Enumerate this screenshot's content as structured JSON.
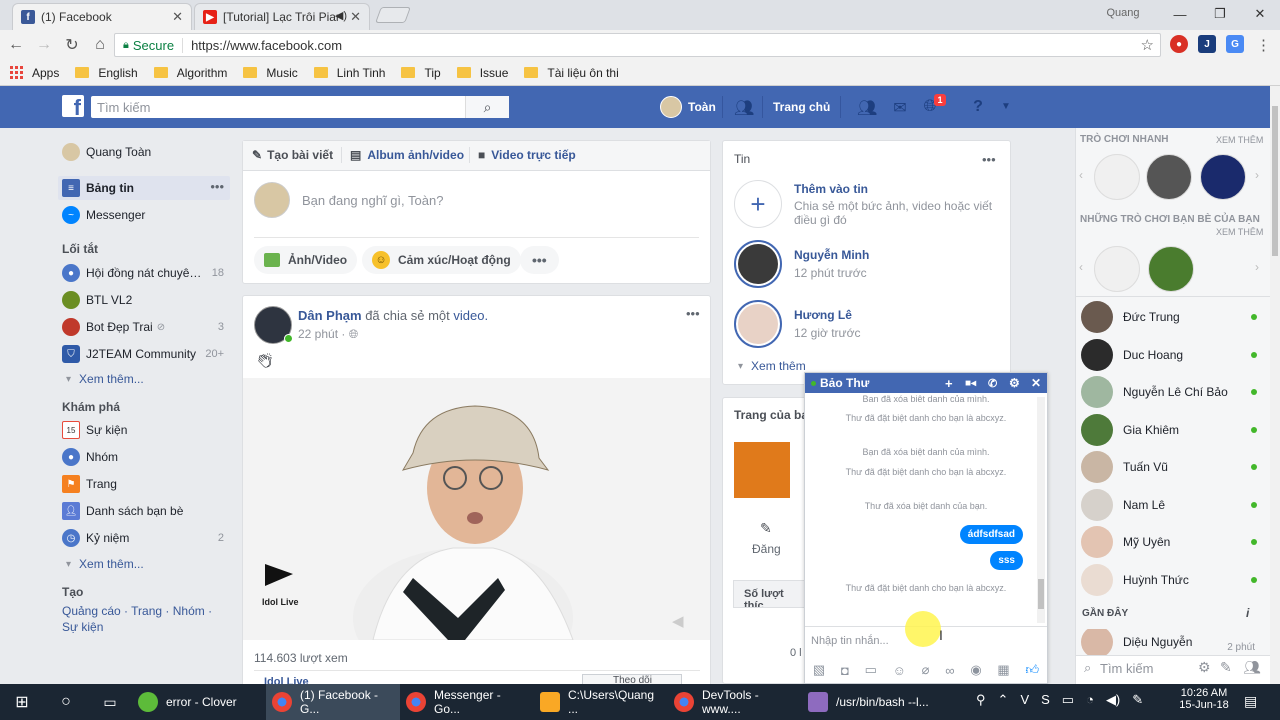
{
  "browser": {
    "tabs": [
      {
        "title": "(1) Facebook",
        "icon": "facebook-icon"
      },
      {
        "title": "[Tutorial] Lạc Trôi Piar",
        "icon": "youtube-icon"
      }
    ],
    "profile": "Quang",
    "secure_label": "Secure",
    "url": "https://www.facebook.com",
    "bookmarks": [
      "Apps",
      "English",
      "Algorithm",
      "Music",
      "Linh Tinh",
      "Tip",
      "Issue",
      "Tài liệu ôn thi"
    ]
  },
  "fb_header": {
    "search_placeholder": "Tìm kiếm",
    "profile_name": "Toàn",
    "home_label": "Trang chủ",
    "notification_count": "1"
  },
  "left_nav": {
    "user": "Quang Toàn",
    "news_feed": "Bảng tin",
    "messenger": "Messenger",
    "shortcuts_title": "Lối tắt",
    "shortcuts": [
      {
        "label": "Hội đồng nát chuyê…",
        "count": "18"
      },
      {
        "label": "BTL VL2",
        "count": ""
      },
      {
        "label": "Bot Đẹp Trai",
        "count": "3"
      },
      {
        "label": "J2TEAM Community",
        "count": "20+"
      }
    ],
    "see_more": "Xem thêm...",
    "explore_title": "Khám phá",
    "explore": [
      {
        "label": "Sự kiện",
        "count": ""
      },
      {
        "label": "Nhóm",
        "count": ""
      },
      {
        "label": "Trang",
        "count": ""
      },
      {
        "label": "Danh sách bạn bè",
        "count": ""
      },
      {
        "label": "Kỷ niệm",
        "count": "2"
      }
    ],
    "see_more2": "Xem thêm...",
    "create_title": "Tạo",
    "create_links": "Quảng cáo · Trang · Nhóm ·",
    "create_links2": "Sự kiện"
  },
  "composer": {
    "tab_post": "Tạo bài viết",
    "tab_album": "Album ảnh/video",
    "tab_live": "Video trực tiếp",
    "placeholder": "Bạn đang nghĩ gì, Toàn?",
    "photo_video": "Ảnh/Video",
    "feeling": "Cảm xúc/Hoạt động"
  },
  "post": {
    "author": "Dân Phạm",
    "action": "đã chia sẻ một",
    "object": "video.",
    "time": "22 phút ·",
    "watermark": "Idol Live",
    "views": "114.603 lượt xem",
    "partial_name": "Idol Live",
    "follow_label": "Theo dõi"
  },
  "stories": {
    "title": "Tin",
    "add_title": "Thêm vào tin",
    "add_sub": "Chia sẻ một bức ảnh, video hoặc viết điều gì đó",
    "items": [
      {
        "name": "Nguyễn Minh",
        "time": "12 phút trước"
      },
      {
        "name": "Hương Lê",
        "time": "12 giờ trước"
      }
    ],
    "see_more": "Xem thêm"
  },
  "pages": {
    "title": "Trang của bạ",
    "post_label": "Đăng",
    "likes_label": "Số lượt thíc",
    "partial": "0 l"
  },
  "chat": {
    "name": "Bảo Thư",
    "messages": [
      "Bạn đã xóa biệt danh của mình.",
      "Thư đã đặt biệt danh cho bạn là abcxyz.",
      "Bạn đã xóa biệt danh của mình.",
      "Thư đã đặt biệt danh cho bạn là abcxyz.",
      "Thư đã xóa biệt danh của bạn."
    ],
    "bubbles": [
      "ádfsdfsad",
      "sss"
    ],
    "last_message": "Thư đã đặt biệt danh cho bạn là abcxyz.",
    "input_placeholder": "Nhập tin nhắn..."
  },
  "sidebar": {
    "quick_games": "TRÒ CHƠI NHANH",
    "see_all": "XEM THÊM",
    "friends_games": "NHỮNG TRÒ CHƠI BẠN BÈ CỦA BẠN",
    "see_all2": "XEM THÊM",
    "contacts": [
      "Đức Trung",
      "Duc Hoang",
      "Nguyễn Lê Chí Bảo",
      "Gia Khiêm",
      "Tuấn Vũ",
      "Nam Lê",
      "Mỹ Uyên",
      "Huỳnh Thức"
    ],
    "recent_title": "GẦN ĐÂY",
    "recent": [
      {
        "name": "Diệu Nguyễn",
        "time": "2 phút"
      }
    ],
    "search_placeholder": "Tìm kiếm"
  },
  "taskbar": {
    "items": [
      "error - Clover",
      "(1) Facebook - G...",
      "Messenger - Go...",
      "C:\\Users\\Quang ...",
      "DevTools - www....",
      "/usr/bin/bash --l..."
    ],
    "time": "10:26 AM",
    "date": "15-Jun-18"
  }
}
